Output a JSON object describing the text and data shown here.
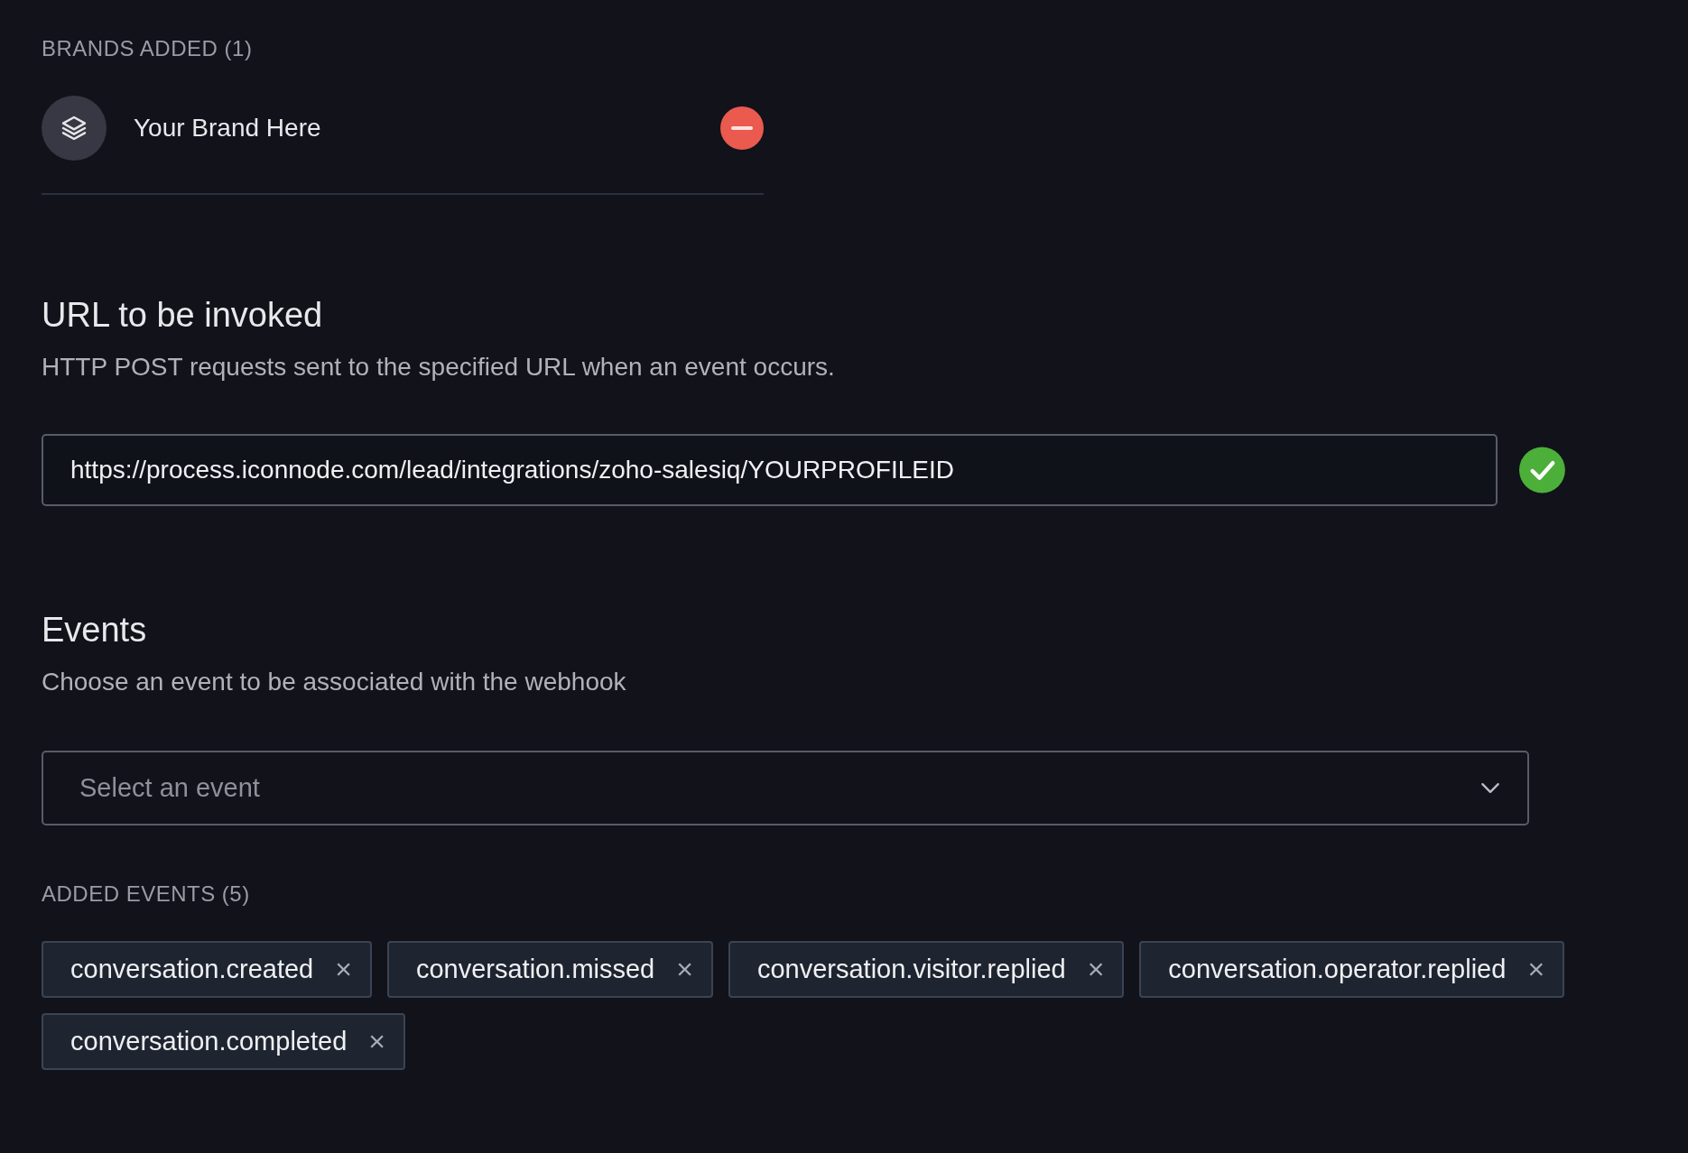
{
  "brands": {
    "heading": "BRANDS ADDED (1)",
    "items": [
      {
        "name": "Your Brand Here"
      }
    ]
  },
  "url_section": {
    "title": "URL to be invoked",
    "description": "HTTP POST requests sent to the specified URL when an event occurs.",
    "value": "https://process.iconnode.com/lead/integrations/zoho-salesiq/YOURPROFILEID",
    "valid": true
  },
  "events_section": {
    "title": "Events",
    "description": "Choose an event to be associated with the webhook",
    "select": {
      "placeholder": "Select an event"
    },
    "added_heading": "ADDED EVENTS (5)",
    "tags": [
      {
        "label": "conversation.created",
        "remove": "×"
      },
      {
        "label": "conversation.missed",
        "remove": "×"
      },
      {
        "label": "conversation.visitor.replied",
        "remove": "×"
      },
      {
        "label": "conversation.operator.replied",
        "remove": "×"
      },
      {
        "label": "conversation.completed",
        "remove": "×"
      }
    ]
  }
}
